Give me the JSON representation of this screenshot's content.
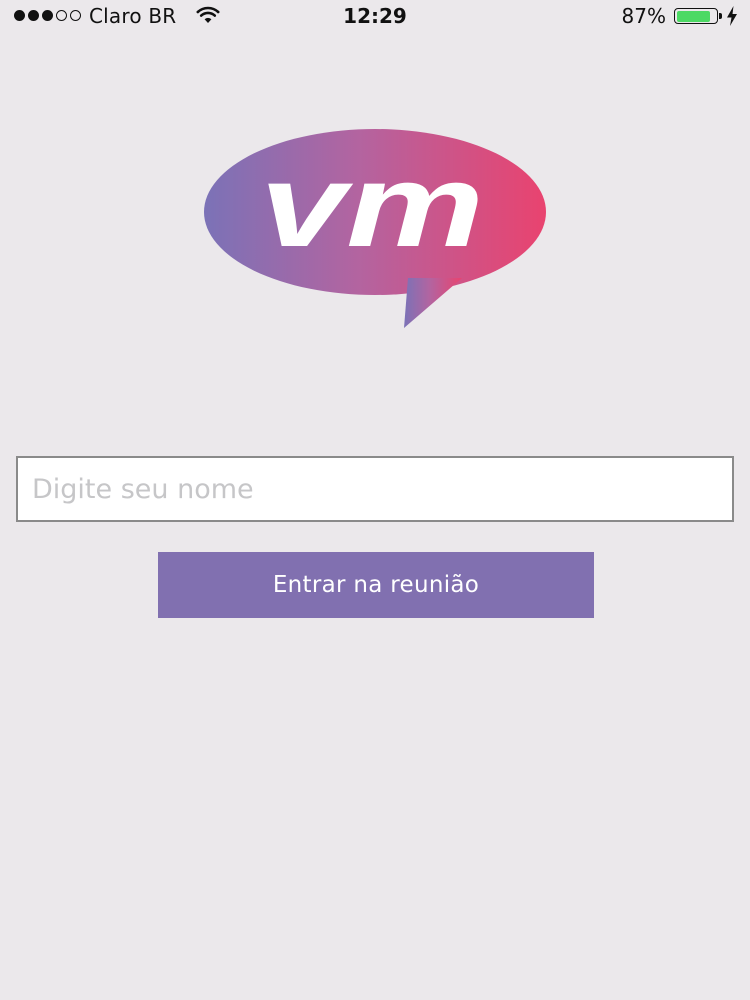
{
  "status_bar": {
    "signal_bars_filled": 3,
    "signal_bars_total": 5,
    "carrier": "Claro BR",
    "wifi_icon": "wifi-icon",
    "time": "12:29",
    "battery_percent": "87%",
    "battery_level": 0.87,
    "battery_color": "#4cd964",
    "charging_icon": "lightning-bolt-icon"
  },
  "logo": {
    "text": "vm",
    "gradient_start": "#7b72b7",
    "gradient_end": "#e9436f"
  },
  "login": {
    "name_placeholder": "Digite seu nome",
    "name_value": "",
    "join_label": "Entrar na reunião",
    "join_color": "#8170b0"
  }
}
